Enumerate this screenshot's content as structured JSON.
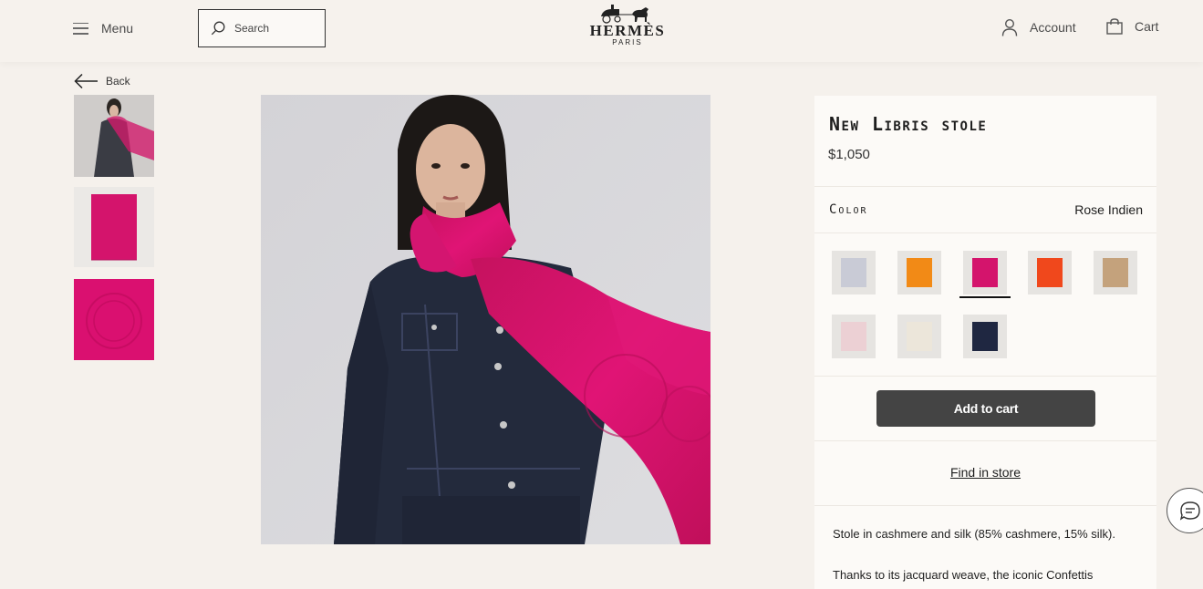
{
  "header": {
    "menu_label": "Menu",
    "search_placeholder": "Search",
    "logo_name": "HERMÈS",
    "logo_sub": "PARIS",
    "account_label": "Account",
    "cart_label": "Cart"
  },
  "back_label": "Back",
  "product": {
    "title": "New Libris stole",
    "price": "$1,050",
    "color_label": "Color",
    "color_value": "Rose Indien",
    "add_to_cart": "Add to cart",
    "find_in_store": "Find in store",
    "description_1": "Stole in cashmere and silk (85% cashmere, 15% silk).",
    "description_2": "Thanks to its jacquard weave, the iconic Confettis"
  },
  "swatch_colors": [
    "#c9cbd6",
    "#f28a16",
    "#d4146c",
    "#f0481c",
    "#c4a27c",
    "#ecd0d4",
    "#ece6da",
    "#1f2741"
  ],
  "selected_swatch": 3,
  "colors": {
    "accent_pink": "#d90f6b",
    "button_dark": "#444444",
    "page_bg": "#f5f1ec"
  }
}
